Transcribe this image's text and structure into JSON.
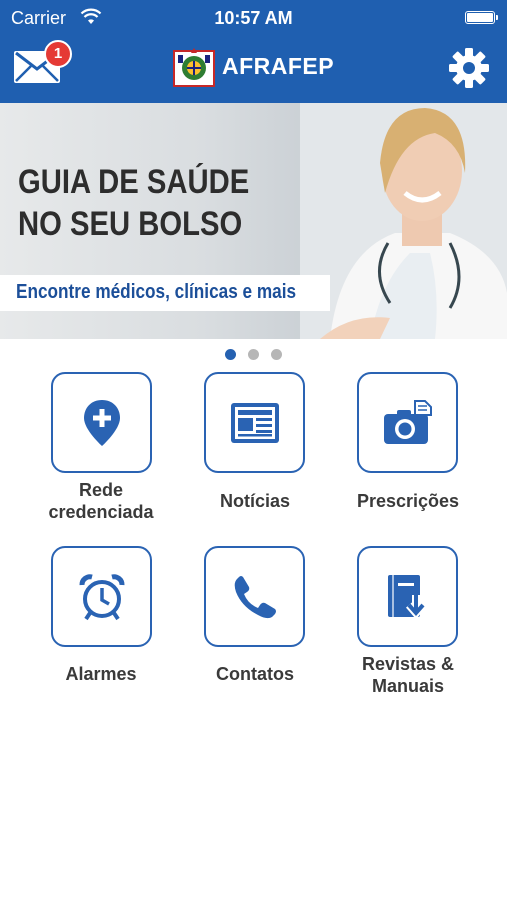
{
  "status_bar": {
    "carrier": "Carrier",
    "time": "10:57 AM"
  },
  "header": {
    "title": "AFRAFEP",
    "mail_badge": "1"
  },
  "banner": {
    "title_line1": "GUIA DE SAÚDE",
    "title_line2": "NO SEU BOLSO",
    "subtitle": "Encontre médicos, clínicas e mais",
    "pages": 3,
    "active_page": 1
  },
  "menu": [
    {
      "label_line1": "Rede",
      "label_line2": "credenciada",
      "icon": "location-plus-icon"
    },
    {
      "label_line1": "Notícias",
      "label_line2": "",
      "icon": "newspaper-icon"
    },
    {
      "label_line1": "Prescrições",
      "label_line2": "",
      "icon": "camera-icon"
    },
    {
      "label_line1": "Alarmes",
      "label_line2": "",
      "icon": "alarm-clock-icon"
    },
    {
      "label_line1": "Contatos",
      "label_line2": "",
      "icon": "phone-icon"
    },
    {
      "label_line1": "Revistas &",
      "label_line2": "Manuais",
      "icon": "book-download-icon"
    }
  ],
  "colors": {
    "primary": "#1f5fb0",
    "accent": "#2a63b3",
    "badge": "#e53a35"
  }
}
